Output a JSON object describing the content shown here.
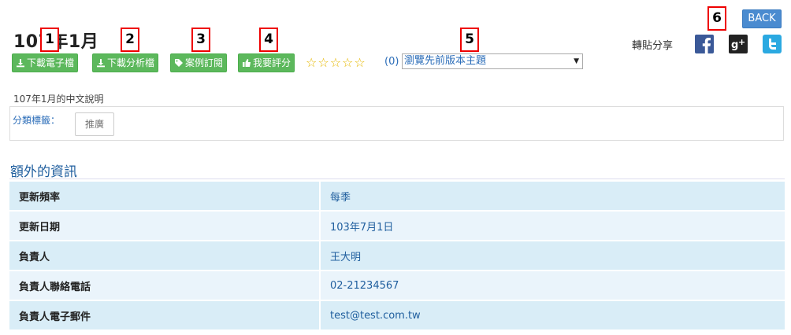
{
  "header": {
    "title": "107年1月",
    "back_label": "BACK",
    "share_label": "轉貼分享"
  },
  "toolbar": {
    "buttons": [
      {
        "label": "下載電子檔",
        "icon": "download-icon"
      },
      {
        "label": "下載分析檔",
        "icon": "download-icon"
      },
      {
        "label": "案例訂閱",
        "icon": "tag-icon"
      },
      {
        "label": "我要評分",
        "icon": "thumbs-up-icon"
      }
    ],
    "rating": {
      "stars": 5,
      "filled": 0,
      "count_text": "(0)"
    },
    "theme_select": {
      "selected": "瀏覽先前版本主題"
    }
  },
  "annotations": [
    "1",
    "2",
    "3",
    "4",
    "5",
    "6"
  ],
  "social": [
    {
      "name": "facebook",
      "color": "#3b5998"
    },
    {
      "name": "google-plus",
      "color": "#222222"
    },
    {
      "name": "twitter",
      "color": "#2ba9e1"
    }
  ],
  "description": "107年1月的中文說明",
  "tags": {
    "label": "分類標籤：",
    "items": [
      "推廣"
    ]
  },
  "extra": {
    "title": "額外的資訊",
    "rows": [
      {
        "key": "更新頻率",
        "value": "每季"
      },
      {
        "key": "更新日期",
        "value": "103年7月1日"
      },
      {
        "key": "負責人",
        "value": "王大明"
      },
      {
        "key": "負責人聯絡電話",
        "value": "02-21234567"
      },
      {
        "key": "負責人電子郵件",
        "value": "test@test.com.tw"
      }
    ]
  },
  "colors": {
    "button_green": "#5cb85c",
    "back_blue": "#4a8bd0",
    "link_blue": "#2a6cb8",
    "annotation_red": "#ee0000"
  }
}
